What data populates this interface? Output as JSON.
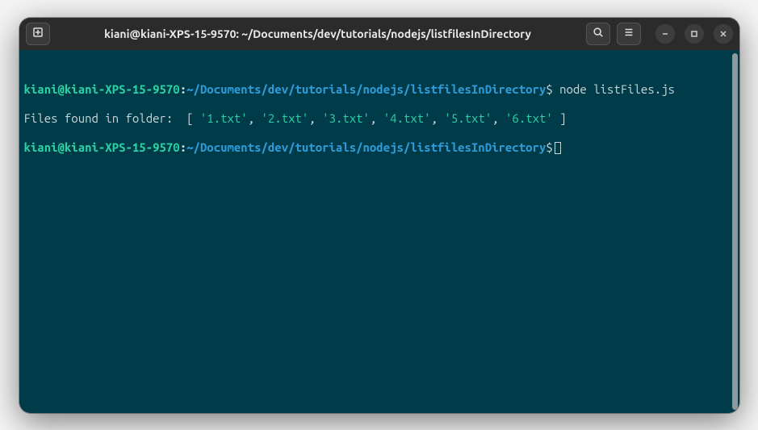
{
  "titlebar": {
    "title": "kiani@kiani-XPS-15-9570: ~/Documents/dev/tutorials/nodejs/listfilesInDirectory"
  },
  "prompt": {
    "userhost": "kiani@kiani-XPS-15-9570",
    "colon": ":",
    "path": "~/Documents/dev/tutorials/nodejs/listfilesInDirectory",
    "dollar": "$"
  },
  "lines": {
    "cmd1": " node listFiles.js",
    "out_prefix": "Files found in folder:  [ ",
    "f1": "'1.txt'",
    "f2": "'2.txt'",
    "f3": "'3.txt'",
    "f4": "'4.txt'",
    "f5": "'5.txt'",
    "f6": "'6.txt'",
    "sep": ", ",
    "out_suffix": " ]"
  }
}
